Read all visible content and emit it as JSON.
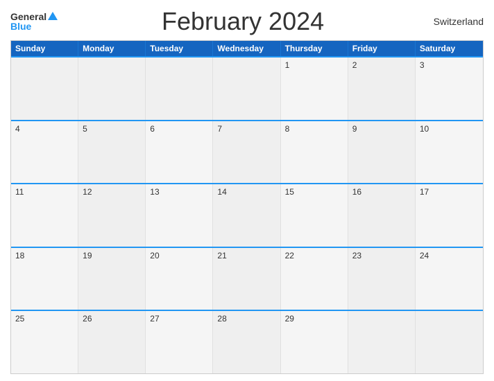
{
  "header": {
    "logo_general": "General",
    "logo_blue": "Blue",
    "title": "February 2024",
    "country": "Switzerland"
  },
  "days_of_week": [
    "Sunday",
    "Monday",
    "Tuesday",
    "Wednesday",
    "Thursday",
    "Friday",
    "Saturday"
  ],
  "weeks": [
    [
      {
        "date": "",
        "empty": true
      },
      {
        "date": "",
        "empty": true
      },
      {
        "date": "",
        "empty": true
      },
      {
        "date": "",
        "empty": true
      },
      {
        "date": "1"
      },
      {
        "date": "2"
      },
      {
        "date": "3"
      }
    ],
    [
      {
        "date": "4"
      },
      {
        "date": "5"
      },
      {
        "date": "6"
      },
      {
        "date": "7"
      },
      {
        "date": "8"
      },
      {
        "date": "9"
      },
      {
        "date": "10"
      }
    ],
    [
      {
        "date": "11"
      },
      {
        "date": "12"
      },
      {
        "date": "13"
      },
      {
        "date": "14"
      },
      {
        "date": "15"
      },
      {
        "date": "16"
      },
      {
        "date": "17"
      }
    ],
    [
      {
        "date": "18"
      },
      {
        "date": "19"
      },
      {
        "date": "20"
      },
      {
        "date": "21"
      },
      {
        "date": "22"
      },
      {
        "date": "23"
      },
      {
        "date": "24"
      }
    ],
    [
      {
        "date": "25"
      },
      {
        "date": "26"
      },
      {
        "date": "27"
      },
      {
        "date": "28"
      },
      {
        "date": "29"
      },
      {
        "date": "",
        "empty": true
      },
      {
        "date": "",
        "empty": true
      }
    ]
  ]
}
